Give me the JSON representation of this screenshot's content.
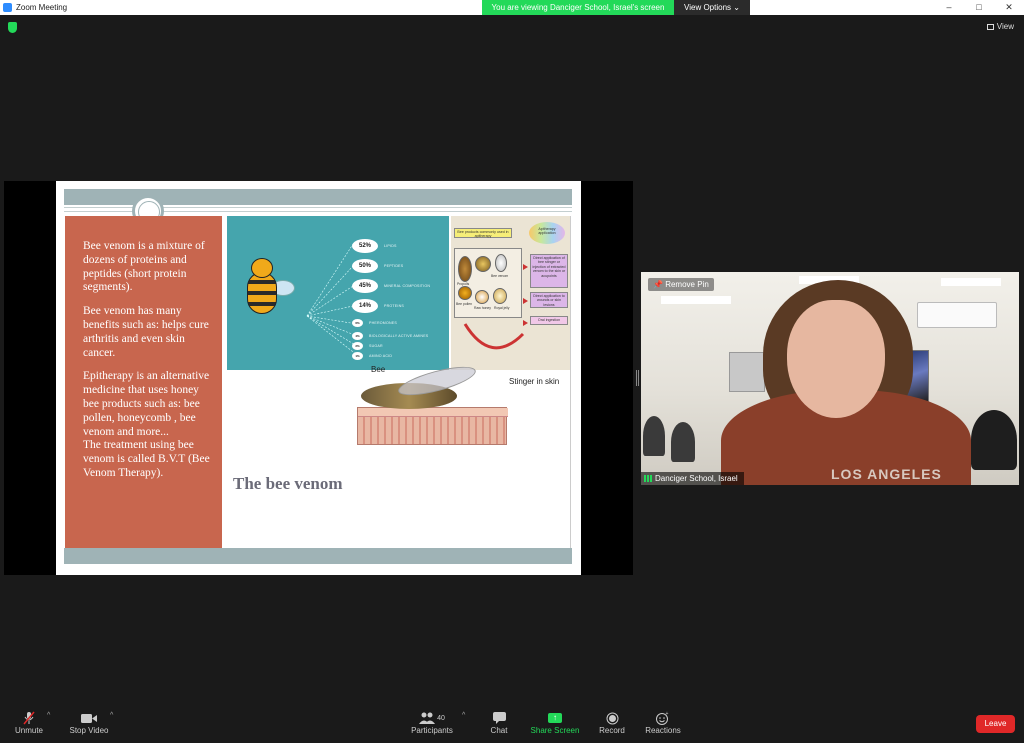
{
  "window": {
    "title": "Zoom Meeting"
  },
  "share_banner": {
    "message": "You are viewing Danciger School, Israel's screen",
    "view_options": "View Options"
  },
  "top": {
    "view_label": "View"
  },
  "slide": {
    "left_text": [
      "Bee venom is a mixture of dozens of proteins and peptides (short protein segments).",
      "Bee venom has many benefits such as: helps cure arthritis and even skin cancer.",
      "Epitherapy is an alternative medicine that uses honey bee products such as: bee pollen, honeycomb , bee venom and more...\nThe treatment using bee venom is called B.V.T (Bee Venom Therapy)."
    ],
    "title": "The bee venom",
    "percentages": [
      {
        "value": "52%",
        "label": "LIPIDS"
      },
      {
        "value": "50%",
        "label": "PEPTIDES"
      },
      {
        "value": "45%",
        "label": "MINERAL COMPOSITION"
      },
      {
        "value": "14%",
        "label": "PROTEINS"
      },
      {
        "value": "6%",
        "label": "PHEROMONES"
      },
      {
        "value": "4%",
        "label": "BIOLOGICALLY ACTIVE AMINES"
      },
      {
        "value": "2%",
        "label": "SUGAR"
      },
      {
        "value": "1%",
        "label": "AMINO ACID"
      }
    ],
    "diagram_labels": {
      "bee": "Bee",
      "stinger": "Stinger in skin"
    },
    "infographic": {
      "products_header": "Bee products commonly used in apitherapy",
      "apitherapy_app": "Apitherapy application",
      "direct_venom": "Direct application of bee stinger or injection of extracted venom to the skin or acupoints",
      "direct_wounds": "Direct application to wounds or skin lesions",
      "oral": "Oral ingestion",
      "propolis": "Propolis",
      "bee_venom": "Bee venom",
      "bee_pollen": "Bee pollen",
      "raw_honey": "Raw honey",
      "royal_jelly": "Royal jelly"
    }
  },
  "video": {
    "remove_pin": "Remove Pin",
    "participant_name": "Danciger School, Israel",
    "shirt_text": "LOS ANGELES"
  },
  "toolbar": {
    "unmute": "Unmute",
    "stop_video": "Stop Video",
    "participants": "Participants",
    "participants_count": "40",
    "chat": "Chat",
    "share_screen": "Share Screen",
    "record": "Record",
    "reactions": "Reactions",
    "leave": "Leave"
  },
  "colors": {
    "share_green": "#23d959",
    "leave_red": "#e02828",
    "slide_orange": "#c8664e",
    "slide_teal": "#45a5ad"
  }
}
